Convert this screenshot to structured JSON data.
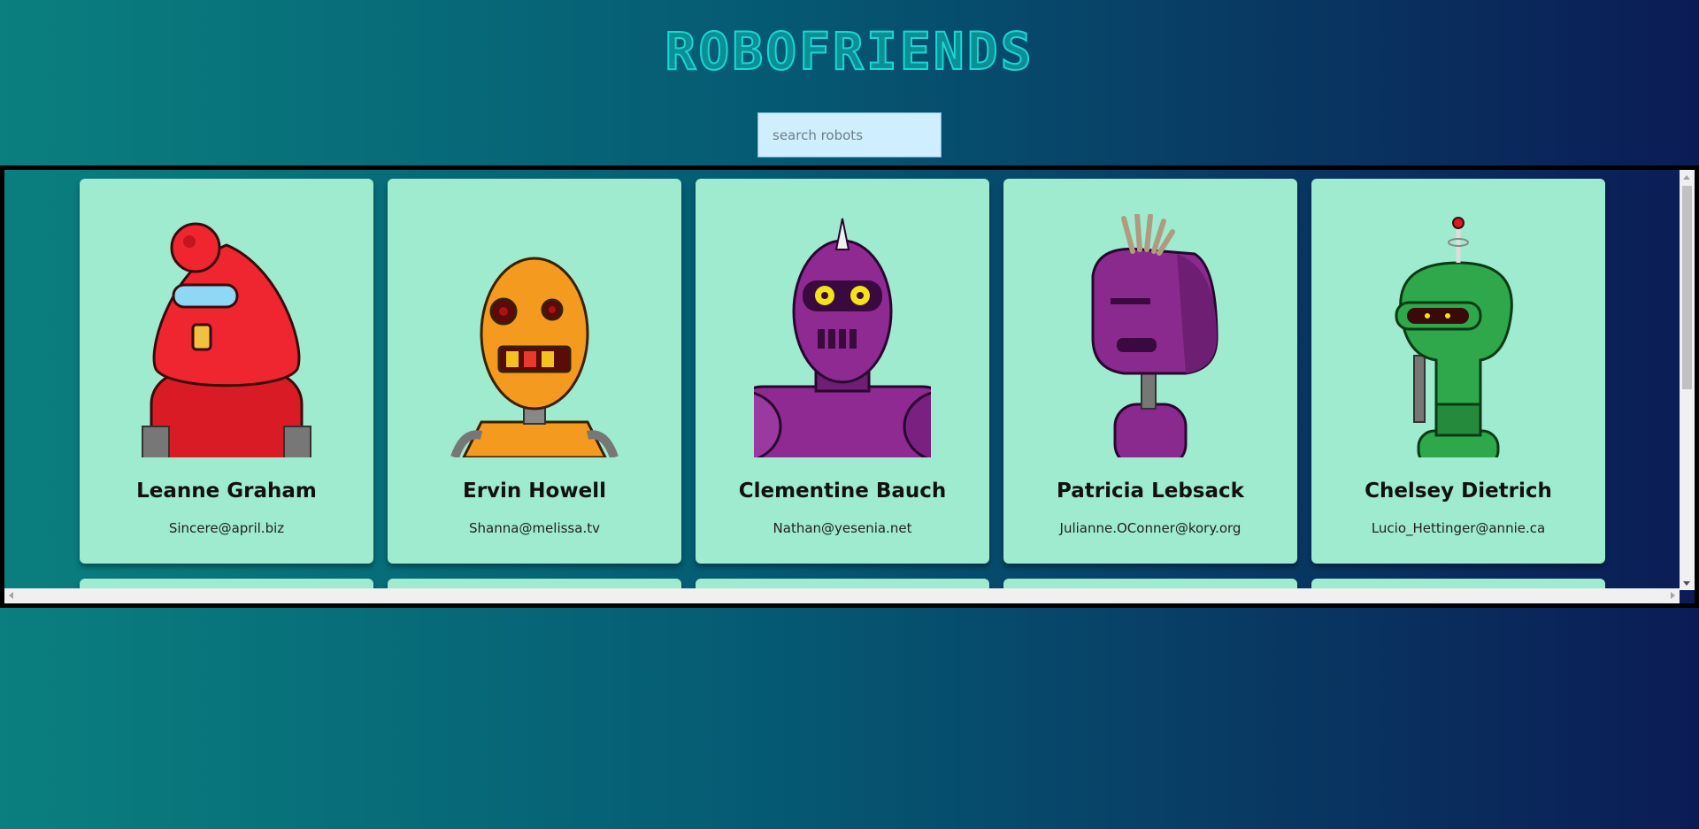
{
  "header": {
    "title": "ROBOFRIENDS"
  },
  "search": {
    "placeholder": "search robots",
    "value": ""
  },
  "robots": [
    {
      "name": "Leanne Graham",
      "email": "Sincere@april.biz",
      "color": "#e8202a",
      "icon": "red-robot-icon"
    },
    {
      "name": "Ervin Howell",
      "email": "Shanna@melissa.tv",
      "color": "#f39a1f",
      "icon": "orange-robot-icon"
    },
    {
      "name": "Clementine Bauch",
      "email": "Nathan@yesenia.net",
      "color": "#8e2a92",
      "icon": "purple-robot-icon"
    },
    {
      "name": "Patricia Lebsack",
      "email": "Julianne.OConner@kory.org",
      "color": "#8b2a8e",
      "icon": "purple-boxhead-robot-icon"
    },
    {
      "name": "Chelsey Dietrich",
      "email": "Lucio_Hettinger@annie.ca",
      "color": "#2ea84a",
      "icon": "green-robot-icon"
    }
  ],
  "colors": {
    "card_background": "#9eebcf",
    "search_background": "#cfeeff",
    "title_color": "#1ad6d6"
  }
}
